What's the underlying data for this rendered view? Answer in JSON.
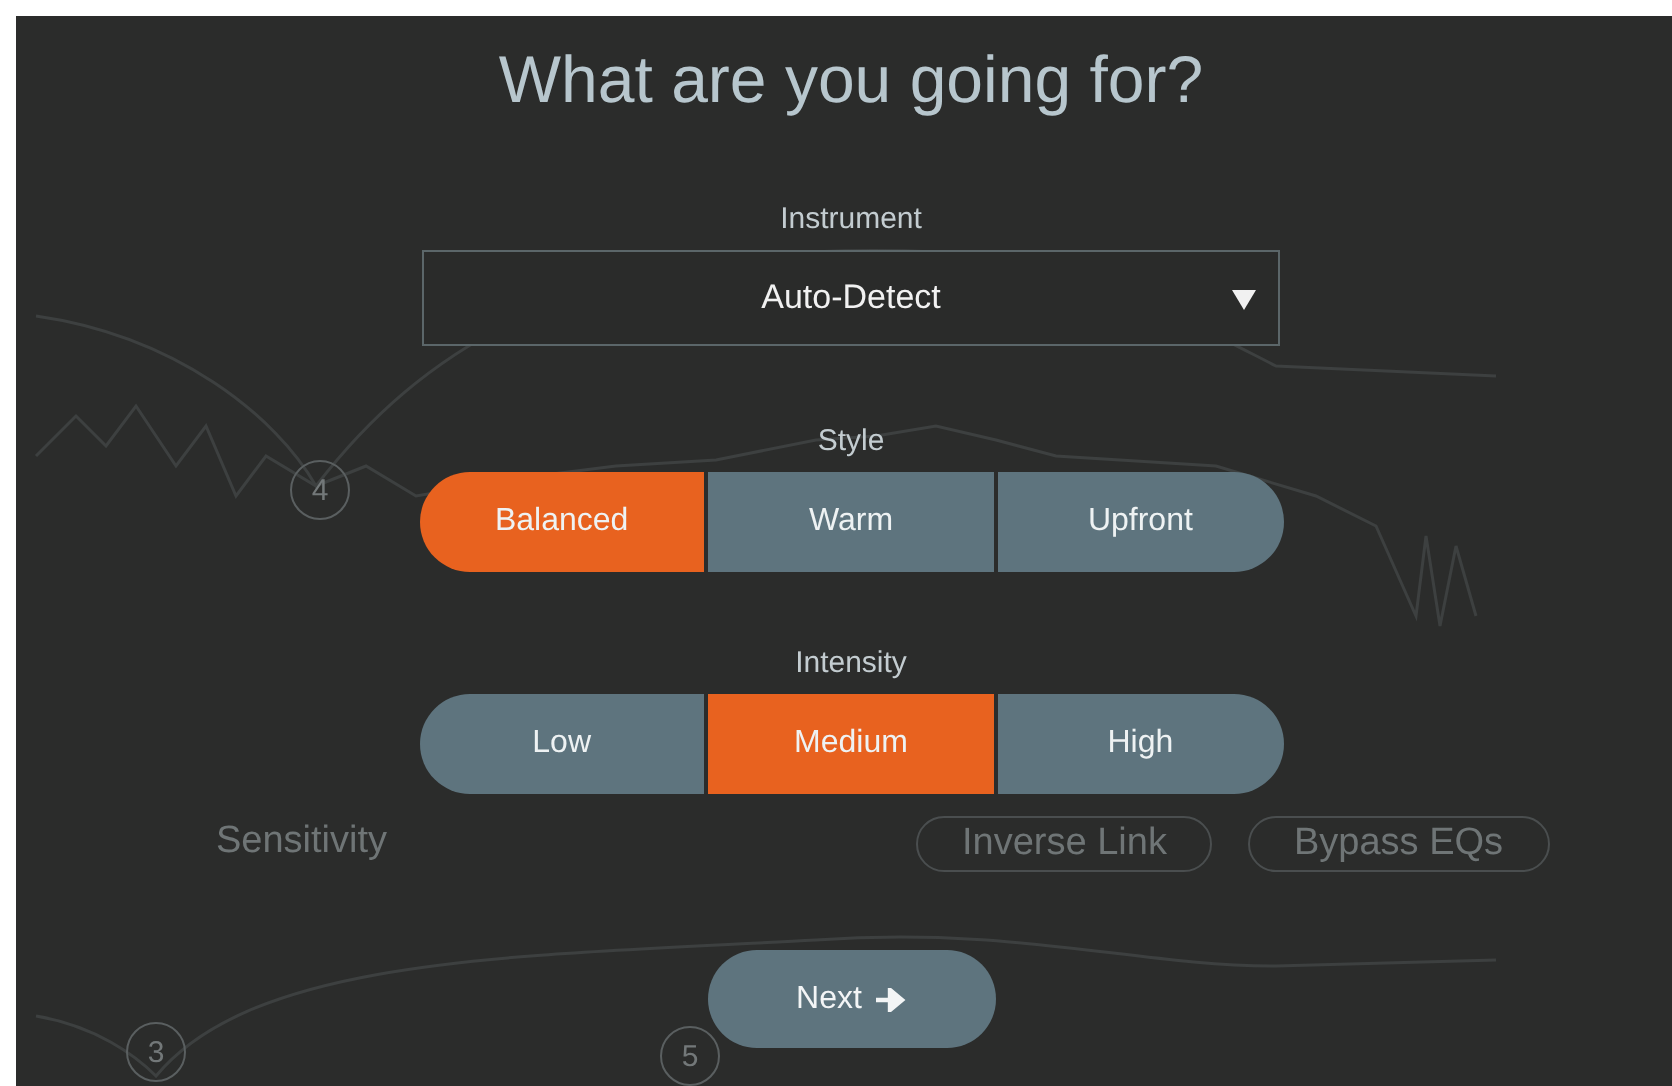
{
  "background": {
    "labels": [
      {
        "kind": "label",
        "text": "Sensitivity"
      },
      {
        "kind": "pill",
        "text": "Inverse Link"
      },
      {
        "kind": "pill",
        "text": "Bypass EQs"
      }
    ],
    "nodes": [
      "4",
      "5",
      "3"
    ]
  },
  "title": "What are you going for?",
  "instrument": {
    "label": "Instrument",
    "value": "Auto-Detect"
  },
  "style": {
    "label": "Style",
    "options": [
      {
        "label": "Balanced",
        "selected": true
      },
      {
        "label": "Warm",
        "selected": false
      },
      {
        "label": "Upfront",
        "selected": false
      }
    ]
  },
  "intensity": {
    "label": "Intensity",
    "options": [
      {
        "label": "Low",
        "selected": false
      },
      {
        "label": "Medium",
        "selected": true
      },
      {
        "label": "High",
        "selected": false
      }
    ]
  },
  "next_button": {
    "label": "Next"
  }
}
